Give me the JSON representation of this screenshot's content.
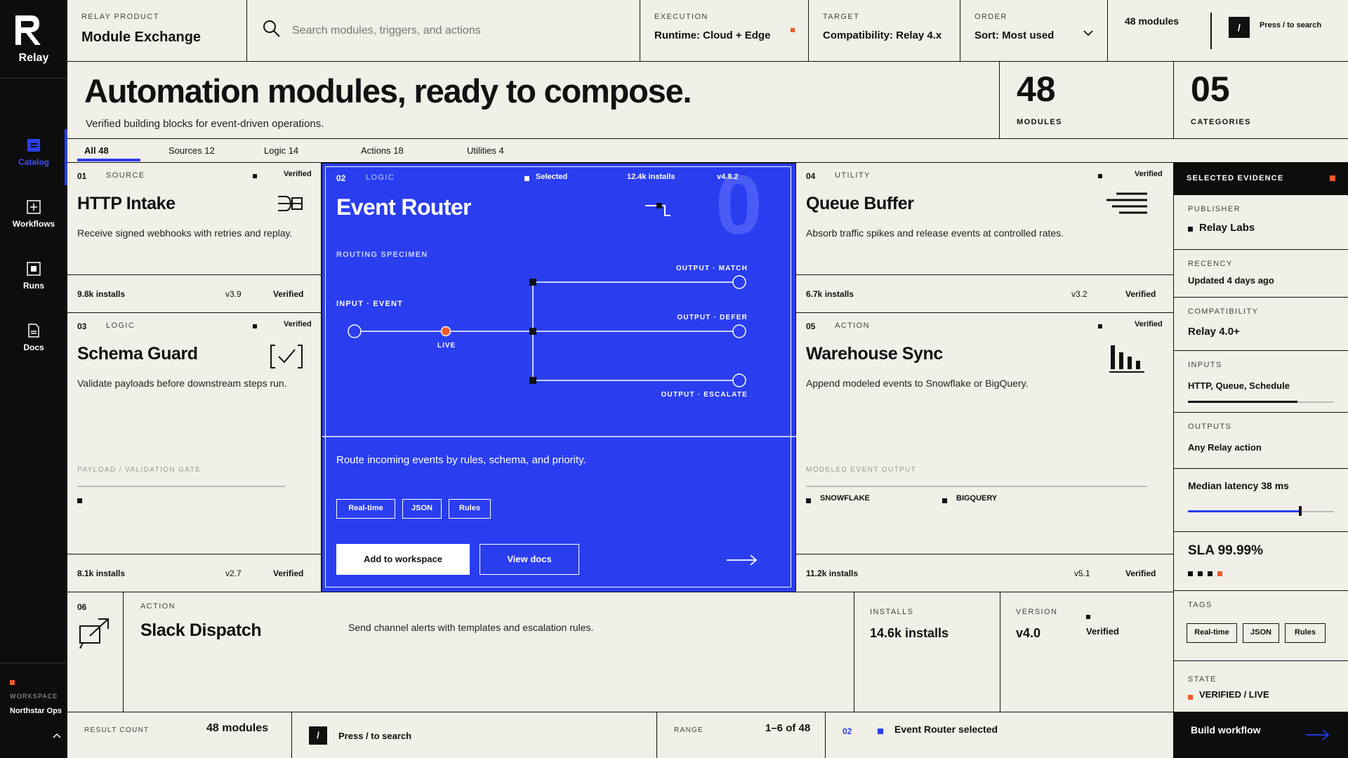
{
  "brand": {
    "name": "Relay"
  },
  "nav": [
    {
      "label": "Catalog"
    },
    {
      "label": "Workflows"
    },
    {
      "label": "Runs"
    },
    {
      "label": "Docs"
    }
  ],
  "workspace": {
    "label": "WORKSPACE",
    "name": "Northstar Ops"
  },
  "product": {
    "label": "RELAY PRODUCT",
    "name": "Module Exchange"
  },
  "search": {
    "placeholder": "Search modules, triggers, and actions"
  },
  "filters": {
    "execution": {
      "label": "EXECUTION",
      "value": "Runtime: Cloud + Edge"
    },
    "target": {
      "label": "TARGET",
      "value": "Compatibility: Relay 4.x"
    },
    "order": {
      "label": "ORDER",
      "value": "Sort: Most used"
    }
  },
  "top_count": "48 modules",
  "shortcut": {
    "key": "/",
    "text": "Press / to search"
  },
  "hero": {
    "title": "Automation modules, ready to compose.",
    "subtitle": "Verified building blocks for event-driven operations."
  },
  "stats": [
    {
      "value": "48",
      "label": "MODULES"
    },
    {
      "value": "05",
      "label": "CATEGORIES"
    }
  ],
  "tabs": [
    {
      "label": "All 48",
      "active": true
    },
    {
      "label": "Sources 12"
    },
    {
      "label": "Logic 14"
    },
    {
      "label": "Actions 18"
    },
    {
      "label": "Utilities 4"
    }
  ],
  "cards": [
    {
      "num": "01",
      "category": "SOURCE",
      "status": "Verified",
      "title": "HTTP Intake",
      "description": "Receive signed webhooks with retries and replay.",
      "installs": "9.8k installs",
      "version": "v3.9",
      "icon": "webhook-intake-icon"
    },
    {
      "num": "03",
      "category": "LOGIC",
      "status": "Verified",
      "title": "Schema Guard",
      "description": "Validate payloads before downstream steps run.",
      "extra_label": "PAYLOAD / VALIDATION GATE",
      "installs": "8.1k installs",
      "version": "v2.7",
      "icon": "checkbox-check-icon"
    },
    {
      "num": "04",
      "category": "UTILITY",
      "status": "Verified",
      "title": "Queue Buffer",
      "description": "Absorb traffic spikes and release events at controlled rates.",
      "installs": "6.7k installs",
      "version": "v3.2",
      "icon": "queue-lines-icon"
    },
    {
      "num": "05",
      "category": "ACTION",
      "status": "Verified",
      "title": "Warehouse Sync",
      "description": "Append modeled events to Snowflake or BigQuery.",
      "extra_label": "MODELED EVENT OUTPUT",
      "legend": [
        "SNOWFLAKE",
        "BIGQUERY"
      ],
      "installs": "11.2k installs",
      "version": "v5.1",
      "icon": "bar-chart-icon"
    }
  ],
  "selected_card": {
    "num": "02",
    "category": "LOGIC",
    "selected_label": "Selected",
    "installs": "12.4k installs",
    "version": "v4.8.2",
    "title": "Event Router",
    "watermark": "0",
    "specimen_label": "ROUTING SPECIMEN",
    "input_label": "INPUT · EVENT",
    "live_label": "LIVE",
    "outputs": [
      "OUTPUT · MATCH",
      "OUTPUT · DEFER",
      "OUTPUT · ESCALATE"
    ],
    "description": "Route incoming events by rules, schema, and priority.",
    "tags": [
      "Real-time",
      "JSON",
      "Rules"
    ],
    "primary_action": "Add to workspace",
    "secondary_action": "View docs"
  },
  "wide_card": {
    "num": "06",
    "category": "ACTION",
    "title": "Slack Dispatch",
    "description": "Send channel alerts with templates and escalation rules.",
    "installs_label": "INSTALLS",
    "installs": "14.6k installs",
    "version_label": "VERSION",
    "version": "v4.0",
    "status": "Verified"
  },
  "evidence": {
    "header": "SELECTED EVIDENCE",
    "publisher_label": "PUBLISHER",
    "publisher": "Relay Labs",
    "recency_label": "RECENCY",
    "recency": "Updated 4 days ago",
    "compat_label": "COMPATIBILITY",
    "compat": "Relay 4.0+",
    "inputs_label": "INPUTS",
    "inputs": "HTTP, Queue, Schedule",
    "inputs_fill": 0.75,
    "outputs_label": "OUTPUTS",
    "outputs": "Any Relay action",
    "latency": "Median latency 38 ms",
    "latency_fraction": 0.77,
    "sla": "SLA 99.99%",
    "tags_label": "TAGS",
    "tags": [
      "Real-time",
      "JSON",
      "Rules"
    ],
    "state_label": "STATE",
    "state": "VERIFIED / LIVE"
  },
  "footer": {
    "result_label": "RESULT COUNT",
    "result_value": "48 modules",
    "shortcut_key": "/",
    "shortcut_text": "Press / to search",
    "range_label": "RANGE",
    "range_value": "1–6 of 48",
    "selected_num": "02",
    "selected_text": "Event Router selected",
    "build_label": "Build workflow"
  },
  "colors": {
    "accent": "#2a3ef0",
    "orange": "#f25a2a",
    "ink": "#111111",
    "paper": "#f0efe8"
  }
}
